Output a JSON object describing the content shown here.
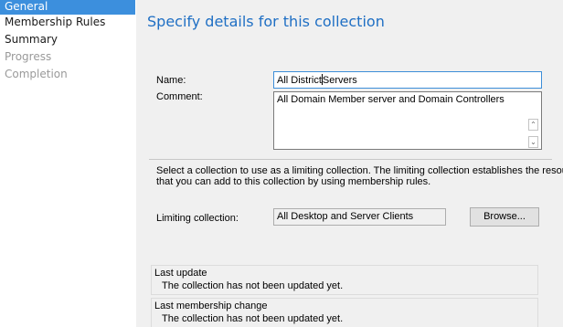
{
  "nav": {
    "items": [
      {
        "label": "General",
        "state": "active"
      },
      {
        "label": "Membership Rules",
        "state": "normal"
      },
      {
        "label": "Summary",
        "state": "normal"
      },
      {
        "label": "Progress",
        "state": "disabled"
      },
      {
        "label": "Completion",
        "state": "disabled"
      }
    ]
  },
  "main": {
    "title": "Specify details for this collection",
    "name_label": "Name:",
    "name_value_before_caret": "All District",
    "name_value_after_caret": "Servers",
    "comment_label": "Comment:",
    "comment_value": "All Domain Member server and Domain Controllers",
    "limiting_description_line1": "Select a collection to use as a limiting collection. The limiting collection establishes the resources",
    "limiting_description_line2": "that you can add to this collection by using membership rules.",
    "limiting_label": "Limiting collection:",
    "limiting_value": "All Desktop and Server Clients",
    "browse_label": "Browse...",
    "last_update_title": "Last update",
    "last_update_text": "The collection has not been updated yet.",
    "last_membership_title": "Last membership change",
    "last_membership_text": "The collection has not been updated yet."
  },
  "colors": {
    "accent": "#3c8fdd",
    "title": "#1f6fc4",
    "panel_bg": "#f0f0f0"
  },
  "icons": {
    "scroll_up": "chevron-up-icon",
    "scroll_down": "chevron-down-icon"
  }
}
